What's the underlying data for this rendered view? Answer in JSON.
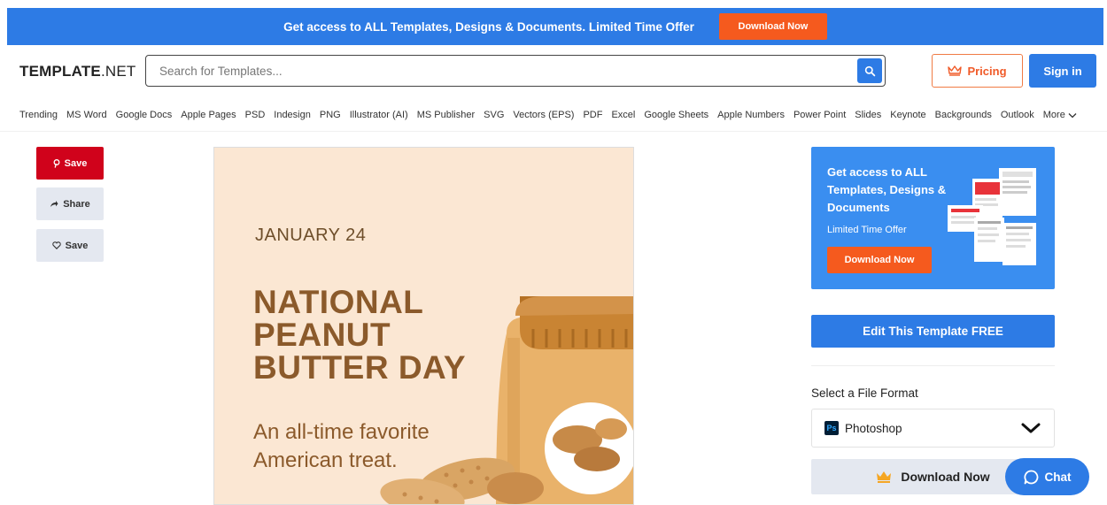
{
  "promo": {
    "text": "Get access to ALL Templates, Designs & Documents. Limited Time Offer",
    "button": "Download Now"
  },
  "header": {
    "logo_bold": "TEMPLATE",
    "logo_light": ".NET",
    "search_placeholder": "Search for Templates...",
    "pricing_label": "Pricing",
    "signin_label": "Sign in"
  },
  "categories": [
    "Trending",
    "MS Word",
    "Google Docs",
    "Apple Pages",
    "PSD",
    "Indesign",
    "PNG",
    "Illustrator (AI)",
    "MS Publisher",
    "SVG",
    "Vectors (EPS)",
    "PDF",
    "Excel",
    "Google Sheets",
    "Apple Numbers",
    "Power Point",
    "Slides",
    "Keynote",
    "Backgrounds",
    "Outlook"
  ],
  "more_label": "More",
  "social": {
    "pin_save": "Save",
    "share": "Share",
    "save": "Save"
  },
  "preview": {
    "date": "JANUARY 24",
    "title_lines": [
      "NATIONAL",
      "PEANUT",
      "BUTTER DAY"
    ],
    "subtitle_lines": [
      "An all-time favorite",
      "American treat."
    ]
  },
  "ad": {
    "title": "Get access to ALL Templates, Designs & Documents",
    "subtitle": "Limited Time Offer",
    "button": "Download Now"
  },
  "edit_button": "Edit This Template FREE",
  "format": {
    "label": "Select a File Format",
    "selected": "Photoshop",
    "icon_text": "Ps"
  },
  "download_label": "Download Now",
  "chat_label": "Chat",
  "colors": {
    "primary": "#2d7be5",
    "accent": "#f55a1e",
    "pin_red": "#d0021b",
    "peanut_brown": "#8b5a2b",
    "preview_bg": "#fbe7d3"
  }
}
